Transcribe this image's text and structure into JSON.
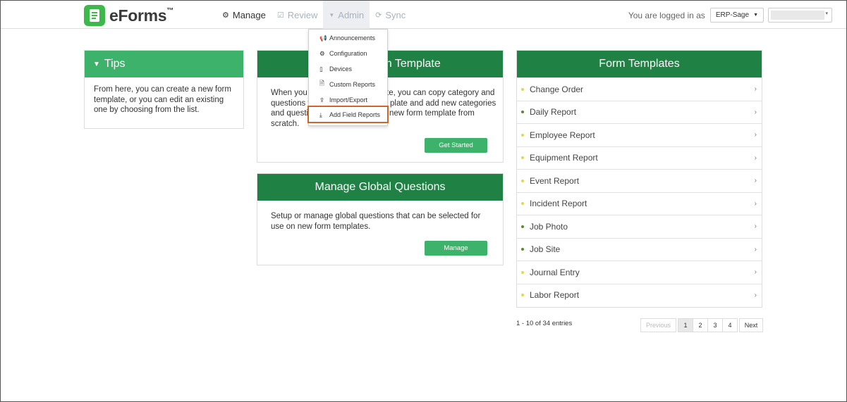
{
  "app": {
    "logo_text": "eForms",
    "logo_tm": "™"
  },
  "nav": {
    "manage": "Manage",
    "review": "Review",
    "admin": "Admin",
    "sync": "Sync"
  },
  "login": {
    "label": "You are logged in as",
    "company": "ERP-Sage"
  },
  "admin_menu": [
    {
      "label": "Announcements",
      "icon": "megaphone-icon"
    },
    {
      "label": "Configuration",
      "icon": "gear-icon"
    },
    {
      "label": "Devices",
      "icon": "mobile-icon"
    },
    {
      "label": "Custom Reports",
      "icon": "file-icon"
    },
    {
      "label": "Import/Export",
      "icon": "upload-icon"
    },
    {
      "label": "Add Field Reports",
      "icon": "download-icon"
    }
  ],
  "tips": {
    "title": "Tips",
    "body": "From here, you can create a new form template, or you can edit an existing one by choosing from the list."
  },
  "new_template": {
    "title_visible": "rm Template",
    "body_line1_a": "When you c",
    "body_line1_b": "te, you can copy category and",
    "body_line2_a": "questions f",
    "body_line2_b": "plate and add new categories",
    "body_line3_a": "and questio",
    "body_line3_b": "new form template from",
    "body_line4": "scratch.",
    "button": "Get Started"
  },
  "global_questions": {
    "title": "Manage Global Questions",
    "body": "Setup or manage global questions that can be selected for use on new form templates.",
    "button": "Manage"
  },
  "form_templates": {
    "title": "Form Templates",
    "items": [
      {
        "label": "Change Order",
        "color": "#e6d64a"
      },
      {
        "label": "Daily Report",
        "color": "#5b8a2e"
      },
      {
        "label": "Employee Report",
        "color": "#e6d64a"
      },
      {
        "label": "Equipment Report",
        "color": "#e6d64a"
      },
      {
        "label": "Event Report",
        "color": "#e6d64a"
      },
      {
        "label": "Incident Report",
        "color": "#e6d64a"
      },
      {
        "label": "Job Photo",
        "color": "#5b8a2e"
      },
      {
        "label": "Job Site",
        "color": "#5b8a2e"
      },
      {
        "label": "Journal Entry",
        "color": "#e6d64a"
      },
      {
        "label": "Labor Report",
        "color": "#e6d64a"
      }
    ],
    "entries": "1 - 10 of 34 entries",
    "pager": {
      "previous": "Previous",
      "pages": [
        "1",
        "2",
        "3",
        "4"
      ],
      "next": "Next"
    }
  },
  "colors": {
    "brand_green": "#3cb94a",
    "header_dark_green": "#1f8244",
    "header_light_green": "#3cb26a",
    "highlight": "#c8692c"
  }
}
